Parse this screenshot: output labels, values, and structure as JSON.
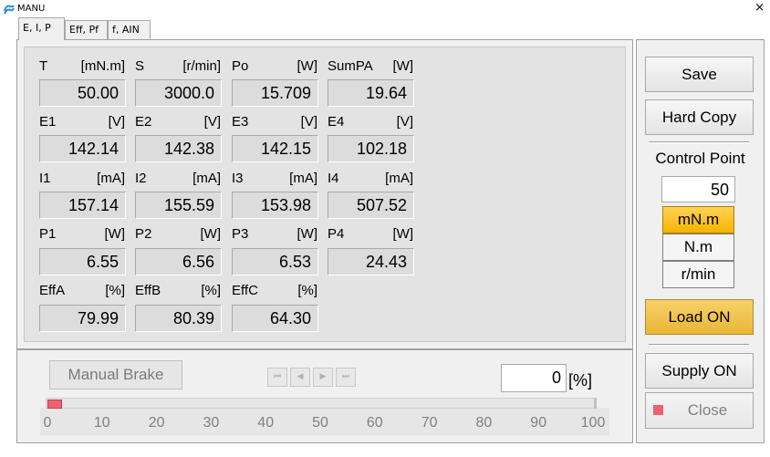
{
  "window": {
    "title": "MANU",
    "close_glyph": "×"
  },
  "tabs": [
    {
      "label": "E, I, P",
      "active": true
    },
    {
      "label": "Eff, Pf",
      "active": false
    },
    {
      "label": "f, AIN",
      "active": false
    }
  ],
  "meters": {
    "T": {
      "name": "T",
      "unit": "[mN.m]",
      "value": "50.00"
    },
    "S": {
      "name": "S",
      "unit": "[r/min]",
      "value": "3000.0"
    },
    "Po": {
      "name": "Po",
      "unit": "[W]",
      "value": "15.709"
    },
    "SumPA": {
      "name": "SumPA",
      "unit": "[W]",
      "value": "19.64"
    },
    "E1": {
      "name": "E1",
      "unit": "[V]",
      "value": "142.14"
    },
    "E2": {
      "name": "E2",
      "unit": "[V]",
      "value": "142.38"
    },
    "E3": {
      "name": "E3",
      "unit": "[V]",
      "value": "142.15"
    },
    "E4": {
      "name": "E4",
      "unit": "[V]",
      "value": "102.18"
    },
    "I1": {
      "name": "I1",
      "unit": "[mA]",
      "value": "157.14"
    },
    "I2": {
      "name": "I2",
      "unit": "[mA]",
      "value": "155.59"
    },
    "I3": {
      "name": "I3",
      "unit": "[mA]",
      "value": "153.98"
    },
    "I4": {
      "name": "I4",
      "unit": "[mA]",
      "value": "507.52"
    },
    "P1": {
      "name": "P1",
      "unit": "[W]",
      "value": "6.55"
    },
    "P2": {
      "name": "P2",
      "unit": "[W]",
      "value": "6.56"
    },
    "P3": {
      "name": "P3",
      "unit": "[W]",
      "value": "6.53"
    },
    "P4": {
      "name": "P4",
      "unit": "[W]",
      "value": "24.43"
    },
    "EffA": {
      "name": "EffA",
      "unit": "[%]",
      "value": "79.99"
    },
    "EffB": {
      "name": "EffB",
      "unit": "[%]",
      "value": "80.39"
    },
    "EffC": {
      "name": "EffC",
      "unit": "[%]",
      "value": "64.30"
    }
  },
  "right": {
    "save": "Save",
    "hard_copy": "Hard Copy",
    "control_point_label": "Control Point",
    "control_point_value": "50",
    "units": [
      "mN.m",
      "N.m",
      "r/min"
    ],
    "selected_unit": "mN.m",
    "load_on": "Load ON",
    "supply_on": "Supply ON",
    "close": "Close"
  },
  "bottom": {
    "manual_brake": "Manual Brake",
    "nav": [
      "⏮",
      "◀",
      "▶",
      "⏭"
    ],
    "percent_value": "0",
    "percent_unit": "[%]",
    "slider_value": 0,
    "scale": [
      "0",
      "10",
      "20",
      "30",
      "40",
      "50",
      "60",
      "70",
      "80",
      "90",
      "100"
    ]
  },
  "colors": {
    "selected": "#f5b400",
    "accent_red": "#f06070",
    "load_on": "#f0c24a"
  }
}
